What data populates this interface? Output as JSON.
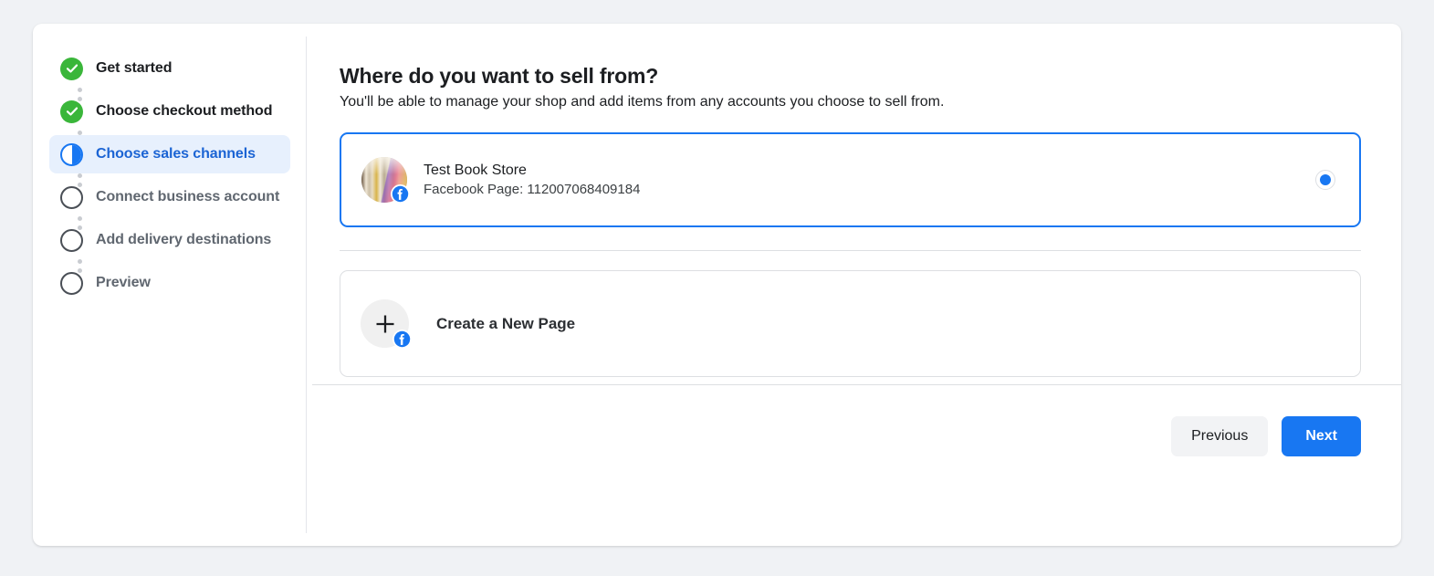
{
  "colors": {
    "page_background": "#f0f2f5",
    "accent_blue": "#1877f2",
    "active_step_text": "#1b64d4",
    "active_step_background": "#e7f0fd",
    "completed_step_green": "#3ab63a",
    "pending_step_text": "#606770",
    "divider": "#dddfe2"
  },
  "stepper": {
    "steps": [
      {
        "label": "Get started",
        "state": "done",
        "icon": "check-circle-icon"
      },
      {
        "label": "Choose checkout method",
        "state": "done",
        "icon": "check-circle-icon"
      },
      {
        "label": "Choose sales channels",
        "state": "active",
        "icon": "half-filled-circle-icon"
      },
      {
        "label": "Connect business account",
        "state": "pending",
        "icon": "empty-circle-icon"
      },
      {
        "label": "Add delivery destinations",
        "state": "pending",
        "icon": "empty-circle-icon"
      },
      {
        "label": "Preview",
        "state": "pending",
        "icon": "empty-circle-icon"
      }
    ]
  },
  "content": {
    "title": "Where do you want to sell from?",
    "subtitle": "You'll be able to manage your shop and add items from any accounts you choose to sell from.",
    "account": {
      "name": "Test Book Store",
      "detail": "Facebook Page: 112007068409184",
      "avatar_icon": "book-store-avatar",
      "badge_icon": "facebook-icon",
      "selected": true
    },
    "create_new": {
      "label": "Create a New Page",
      "icon": "plus-icon",
      "badge_icon": "facebook-icon"
    }
  },
  "footer": {
    "previous_label": "Previous",
    "next_label": "Next"
  }
}
